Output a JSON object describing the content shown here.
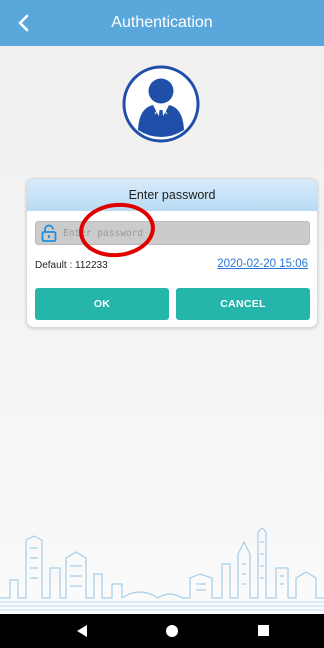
{
  "header": {
    "title": "Authentication",
    "back_icon": "chevron-left-icon"
  },
  "avatar": {
    "icon": "businessman-icon",
    "color": "#1f4fa8"
  },
  "dialog": {
    "title": "Enter password",
    "password": {
      "placeholder": "Enter password",
      "value": "",
      "icon": "lock-icon"
    },
    "default_text": "Default : 112233",
    "date_link": "2020-02-20 15:06",
    "ok_label": "OK",
    "cancel_label": "CANCEL"
  },
  "colors": {
    "header": "#5aa7dc",
    "button": "#26b5aa",
    "link": "#2b77d3",
    "annotation": "#e10000",
    "skyline": "#a7cde8"
  },
  "navbar": {
    "icons": [
      "back-triangle-icon",
      "home-circle-icon",
      "recent-square-icon"
    ]
  }
}
